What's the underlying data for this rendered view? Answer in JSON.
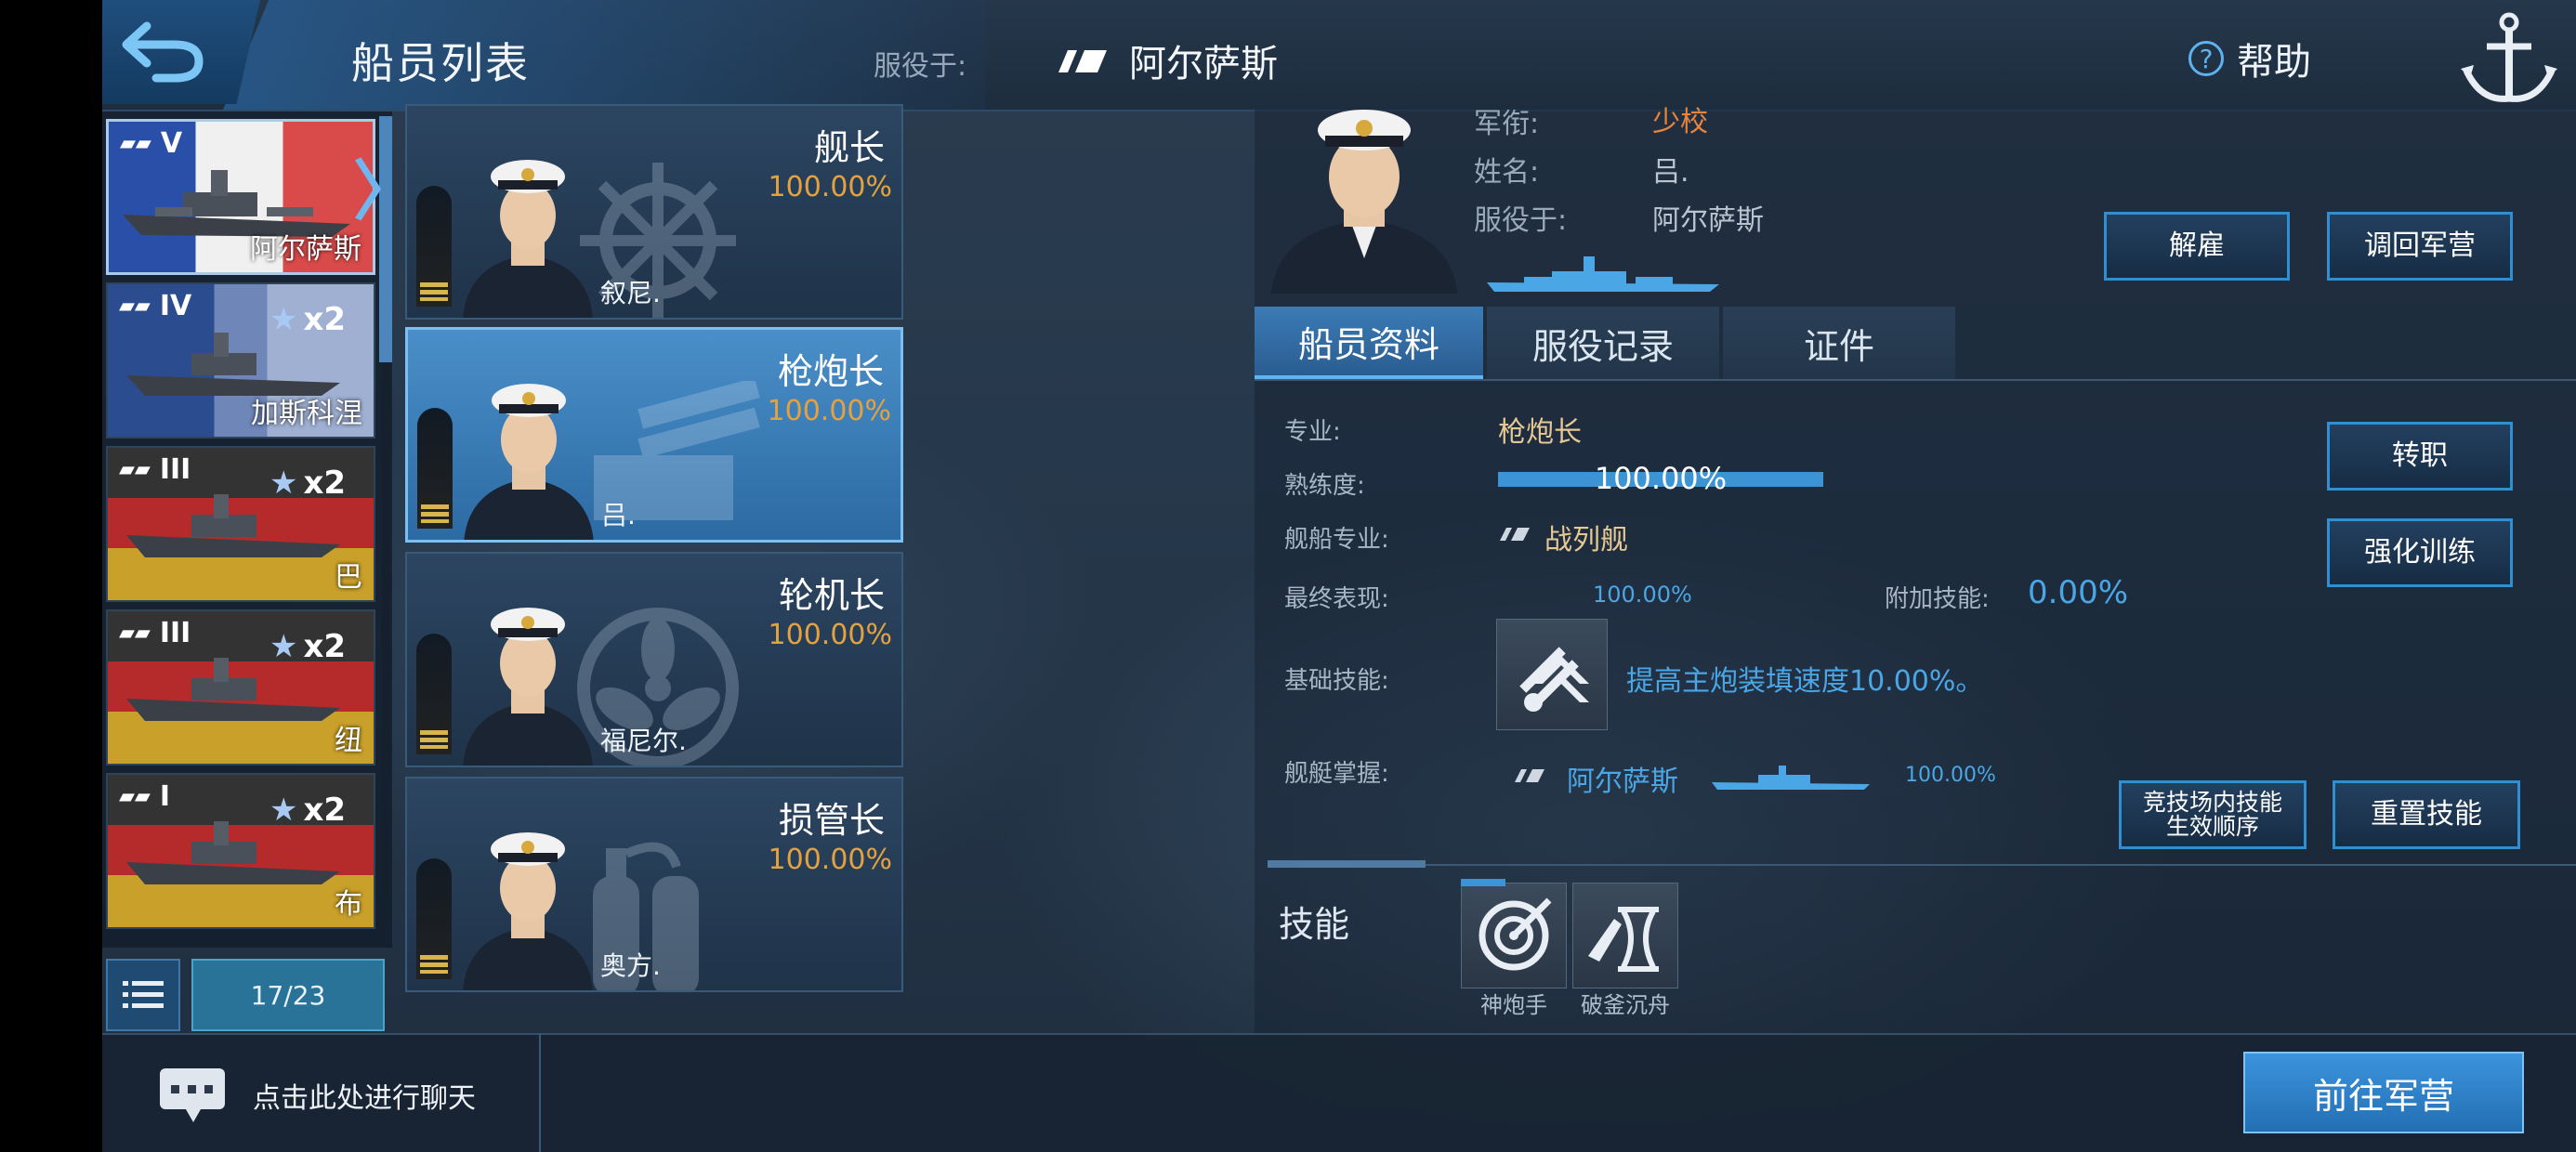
{
  "header": {
    "title": "船员列表",
    "serving_label": "服役于:",
    "serving_ship": "阿尔萨斯",
    "help": "帮助"
  },
  "ships": [
    {
      "tier": "V",
      "name": "阿尔萨斯",
      "multiplier": "",
      "selected": true
    },
    {
      "tier": "IV",
      "name": "加斯科涅",
      "multiplier": "x2"
    },
    {
      "tier": "III",
      "name": "巴",
      "multiplier": "x2"
    },
    {
      "tier": "III",
      "name": "纽",
      "multiplier": "x2"
    },
    {
      "tier": "I",
      "name": "布",
      "multiplier": "x2"
    }
  ],
  "page_count": "17/23",
  "crew": [
    {
      "role": "舰长",
      "pct": "100.00%",
      "name": "叙尼."
    },
    {
      "role": "枪炮长",
      "pct": "100.00%",
      "name": "吕.",
      "selected": true
    },
    {
      "role": "轮机长",
      "pct": "100.00%",
      "name": "福尼尔."
    },
    {
      "role": "损管长",
      "pct": "100.00%",
      "name": "奥方."
    }
  ],
  "profile": {
    "rank_label": "军衔:",
    "rank": "少校",
    "name_label": "姓名:",
    "name": "吕.",
    "serve_label": "服役于:",
    "serve": "阿尔萨斯"
  },
  "actions": {
    "dismiss": "解雇",
    "recall": "调回军营",
    "transfer": "转职",
    "train": "强化训练",
    "arena_order": "竞技场内技能\n生效顺序",
    "reset_skills": "重置技能",
    "goto_barracks": "前往军营"
  },
  "tabs": [
    "船员资料",
    "服役记录",
    "证件"
  ],
  "details": {
    "specialty_label": "专业:",
    "specialty": "枪炮长",
    "proficiency_label": "熟练度:",
    "proficiency": "100.00%",
    "proficiency_value": 1.0,
    "ship_spec_label": "舰船专业:",
    "ship_spec": "战列舰",
    "final_label": "最终表现:",
    "final": "100.00%",
    "bonus_label": "附加技能:",
    "bonus": "0.00%",
    "base_skill_label": "基础技能:",
    "base_skill": "提高主炮装填速度10.00%。",
    "mastery_label": "舰艇掌握:",
    "mastery_ship": "阿尔萨斯",
    "mastery_pct": "100.00%"
  },
  "skills": {
    "label": "技能",
    "items": [
      "神炮手",
      "破釜沉舟"
    ]
  },
  "chat": "点击此处进行聊天"
}
